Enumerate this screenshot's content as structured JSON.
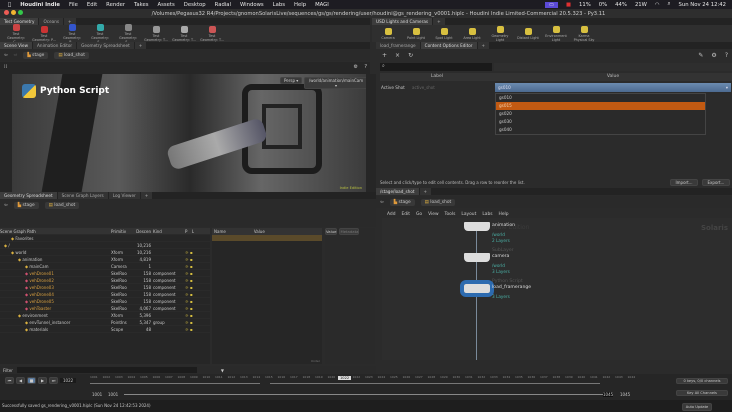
{
  "menubar": {
    "app": "Houdini Indie",
    "items": [
      "File",
      "Edit",
      "Render",
      "Takes",
      "Assets",
      "Desktop",
      "Radial",
      "Windows",
      "Labs",
      "Help",
      "MAGI"
    ],
    "status": [
      "11%",
      "0%",
      "44%",
      "21W"
    ],
    "datetime": "Sun Nov 24  12:42"
  },
  "window": {
    "title": "/Volumes/Pegasus32 R4/Projects/gnomonSolarisLive/sequences/gs/gs/rendering/user/houdini@gs_rendering_v0001.hiplc - Houdini Indie Limited-Commercial 20.5.323 - Py3.11"
  },
  "shelf_left": {
    "tabs": [
      "Test Geometry",
      "Oceans"
    ],
    "tools": [
      "Test Geometry: C...",
      "Test Geometry: P...",
      "Test Geometry: R...",
      "Test Geometry: S...",
      "Test Geometry: S...",
      "Test Geometry: T...",
      "Test Geometry: T...",
      "Test Geometry: T..."
    ]
  },
  "shelf_right": {
    "tabs": [
      "USD Lights and Cameras"
    ],
    "tools": [
      "Camera",
      "Point Light",
      "Spot Light",
      "Area Light",
      "Geometry Light",
      "Distant Light",
      "Environment Light",
      "Karma Physical Sky"
    ]
  },
  "left_panes": {
    "tabs": [
      "Scene View",
      "Animation Editor",
      "Geometry Spreadsheet"
    ]
  },
  "path": {
    "stage": "stage",
    "node": "load_shot"
  },
  "viewport": {
    "overlay_title": "Python Script",
    "persp": "Persp",
    "camera": "/world/animation/mainCam",
    "edition": "Indie Edition"
  },
  "content_options": {
    "tabs": [
      "load_framerange",
      "Content Options Editor"
    ],
    "label_header": "Label",
    "value_header": "Value",
    "row_label": "Active Shot",
    "row_name": "active_shot",
    "selected": "gs010",
    "options": [
      "gs010",
      "gs015",
      "gs020",
      "gs030",
      "gs040"
    ],
    "highlighted_index": 1,
    "hint": "Select and click/type to edit cell contents. Drag a row to reorder the list.",
    "import": "Import...",
    "export": "Export..."
  },
  "spreadsheet": {
    "tabs": [
      "Geometry Spreadsheet",
      "Scene Graph Layers",
      "Log Viewer"
    ],
    "headers": [
      "Scene Graph Path",
      "Primitiv",
      "Descen",
      "Kind",
      "P",
      "L"
    ],
    "rows": [
      {
        "path": "Favorites",
        "type": "",
        "desc": "",
        "kind": "",
        "indent": 1,
        "color": "#c8c8c8"
      },
      {
        "path": "/",
        "type": "",
        "desc": "10,216",
        "kind": "",
        "indent": 0,
        "color": "#c8c8c8"
      },
      {
        "path": "world",
        "type": "Xform",
        "desc": "10,216",
        "kind": "",
        "indent": 1,
        "color": "#c8c8c8"
      },
      {
        "path": "animation",
        "type": "Xform",
        "desc": "4,819",
        "kind": "",
        "indent": 2,
        "color": "#c8c8c8"
      },
      {
        "path": "mainCam",
        "type": "Camera",
        "desc": "1",
        "kind": "",
        "indent": 3,
        "color": "#c8c8c8"
      },
      {
        "path": "vehDrone01",
        "type": "SkelRoo",
        "desc": "158",
        "kind": "component",
        "indent": 3,
        "color": "#d9a040"
      },
      {
        "path": "vehDrone02",
        "type": "SkelRoo",
        "desc": "158",
        "kind": "component",
        "indent": 3,
        "color": "#d9a040"
      },
      {
        "path": "vehDrone03",
        "type": "SkelRoo",
        "desc": "158",
        "kind": "component",
        "indent": 3,
        "color": "#d9a040"
      },
      {
        "path": "vehDrone04",
        "type": "SkelRoo",
        "desc": "158",
        "kind": "component",
        "indent": 3,
        "color": "#d9a040"
      },
      {
        "path": "vehDrone05",
        "type": "SkelRoo",
        "desc": "158",
        "kind": "component",
        "indent": 3,
        "color": "#d9a040"
      },
      {
        "path": "vehToaster",
        "type": "SkelRoo",
        "desc": "4,067",
        "kind": "component",
        "indent": 3,
        "color": "#d9a040"
      },
      {
        "path": "environment",
        "type": "Xform",
        "desc": "5,396",
        "kind": "",
        "indent": 2,
        "color": "#c8c8c8"
      },
      {
        "path": "envTunnel_instancer",
        "type": "PointIns",
        "desc": "5,347",
        "kind": "group",
        "indent": 3,
        "color": "#c8c8c8"
      },
      {
        "path": "materials",
        "type": "Scope",
        "desc": "48",
        "kind": "",
        "indent": 3,
        "color": "#c8c8c8"
      }
    ],
    "attr_headers": [
      "Name",
      "Value"
    ],
    "value_tabs": [
      "Value",
      "Metadata"
    ],
    "filter": "Filter",
    "slider_label": "Under"
  },
  "network": {
    "tab": "/stage/load_shot",
    "menu": [
      "Add",
      "Edit",
      "Go",
      "View",
      "Tools",
      "Layout",
      "Labs",
      "Help"
    ],
    "watermark": "Indie Edition",
    "context": "Solaris",
    "nodes": [
      {
        "type": "",
        "name": "animation",
        "path": "/world",
        "layers": "2 Layers"
      },
      {
        "type": "SubLayer",
        "name": "camera",
        "path": "/world",
        "layers": "3 Layers"
      },
      {
        "type": "Python Script",
        "name": "load_framerange",
        "path": "",
        "layers": "3 Layers"
      }
    ]
  },
  "playbar": {
    "frame": "1022",
    "start": "1001",
    "start2": "1001",
    "end": "1045",
    "end2": "1045",
    "ticks": [
      "1001",
      "1002",
      "1003",
      "1004",
      "1005",
      "1006",
      "1007",
      "1008",
      "1009",
      "1010",
      "1011",
      "1012",
      "1013",
      "1014",
      "1015",
      "1016",
      "1017",
      "1018",
      "1019",
      "1020",
      "1021",
      "1022",
      "1023",
      "1024",
      "1025",
      "1026",
      "1027",
      "1028",
      "1029",
      "1030",
      "1031",
      "1032",
      "1033",
      "1034",
      "1035",
      "1036",
      "1037",
      "1038",
      "1039",
      "1040",
      "1041",
      "1042",
      "1043",
      "1044"
    ],
    "keys": "0 keys, 0/0 channels",
    "channels": "Key All Channels",
    "auto_update": "Auto Update"
  },
  "status": {
    "message": "Successfully saved gs_rendering_v0001.hiplc (Sun Nov 24 12:42:53 2024)"
  },
  "colors": {
    "accent_orange": "#c25a12",
    "selection_blue": "#5a7a9e",
    "node_select": "#2d6bb0"
  }
}
